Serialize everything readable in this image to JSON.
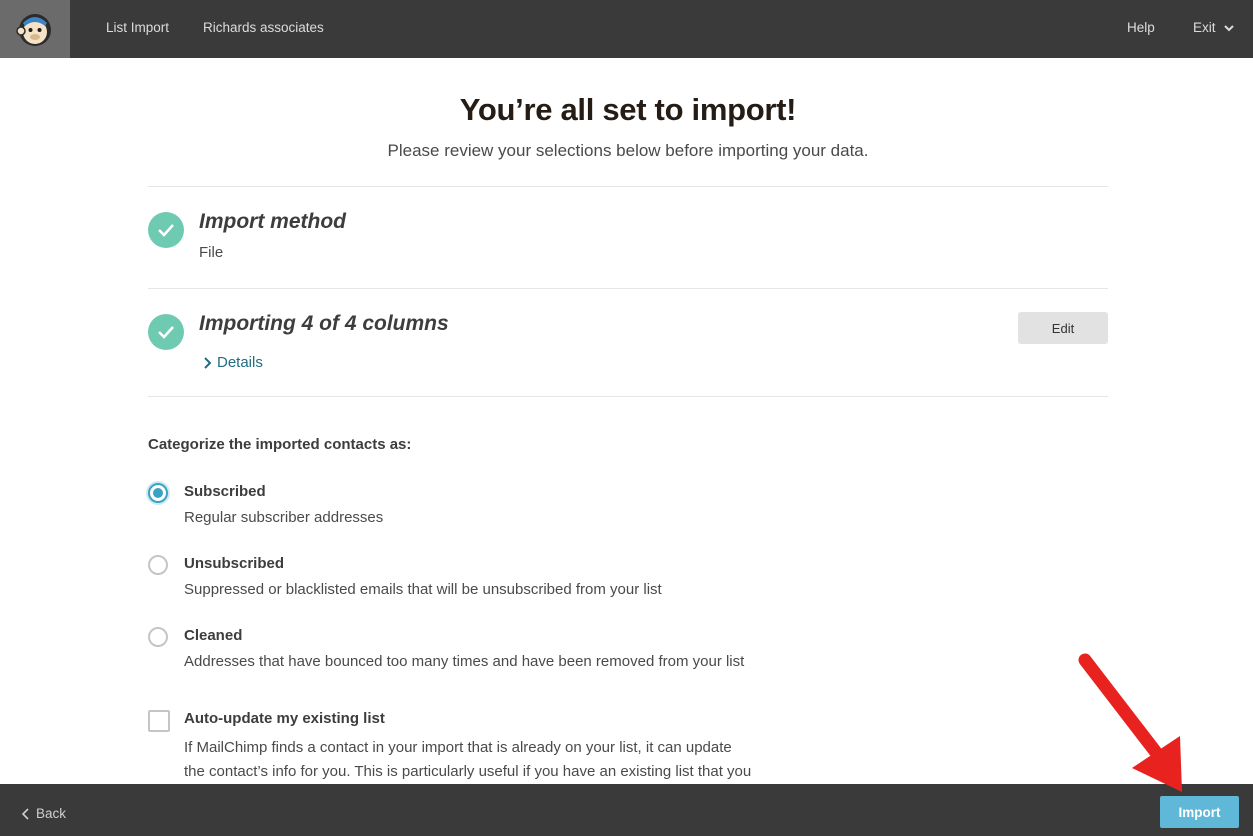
{
  "topbar": {
    "logo_icon": "mailchimp-monkey-logo",
    "links": [
      "List Import",
      "Richards associates"
    ],
    "help_label": "Help",
    "exit_label": "Exit"
  },
  "main": {
    "title": "You’re all set to import!",
    "subtitle": "Please review your selections below before importing your data.",
    "sections": [
      {
        "title": "Import method",
        "value": "File",
        "status_icon": "check-circle-icon"
      },
      {
        "title": "Importing 4 of 4 columns",
        "details_label": "Details",
        "edit_label": "Edit",
        "status_icon": "check-circle-icon"
      }
    ],
    "categorize_label": "Categorize the imported contacts as:",
    "options": [
      {
        "label": "Subscribed",
        "description": "Regular subscriber addresses",
        "selected": true
      },
      {
        "label": "Unsubscribed",
        "description": "Suppressed or blacklisted emails that will be unsubscribed from your list",
        "selected": false
      },
      {
        "label": "Cleaned",
        "description": "Addresses that have bounced too many times and have been removed from your list",
        "selected": false
      }
    ],
    "auto_update": {
      "label": "Auto-update my existing list",
      "description_line1": "If MailChimp finds a contact in your import that is already on your list, it can update",
      "description_line2": "the contact’s info for you. This is particularly useful if you have an existing list that you",
      "checked": false
    }
  },
  "footer": {
    "back_label": "Back",
    "import_label": "Import"
  },
  "colors": {
    "topbar": "#3a3a3a",
    "check": "#6ecab1",
    "accent": "#3aa3c5",
    "import_button": "#5fb8d8",
    "annotation_arrow": "#e8231f"
  }
}
